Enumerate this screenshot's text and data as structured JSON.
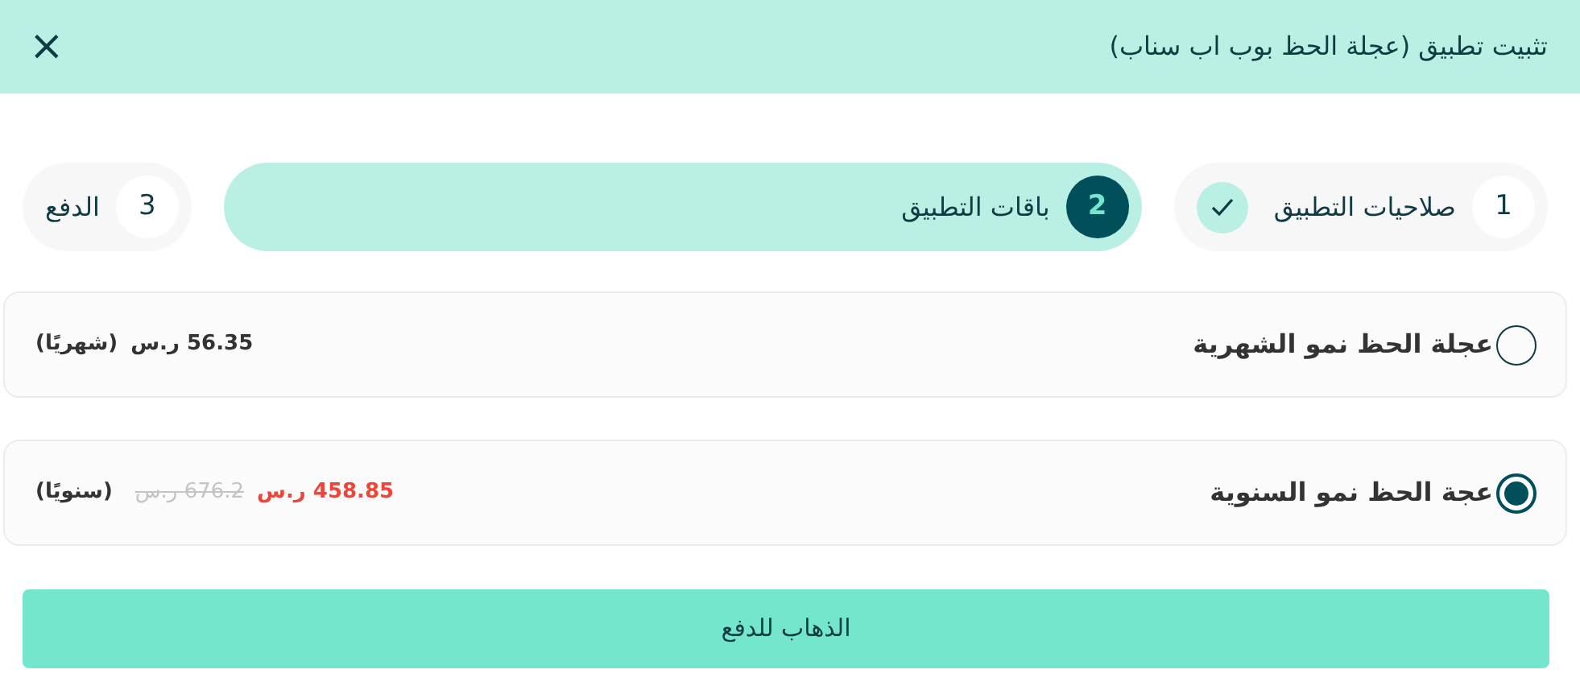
{
  "dialog": {
    "title": "تثبيت تطبيق (عجلة الحظ بوب اب سناب)",
    "close": "×"
  },
  "steps": [
    {
      "number": "1",
      "label": "صلاحيات التطبيق",
      "selected": false,
      "completed": true
    },
    {
      "number": "2",
      "label": "باقات التطبيق",
      "selected": true,
      "completed": false
    },
    {
      "number": "3",
      "label": "الدفع",
      "selected": false,
      "completed": false
    }
  ],
  "plans": [
    {
      "name": "عجلة الحظ نمو الشهرية",
      "selected": false,
      "price": "56.35 ر.س",
      "period": "(شهريًا)"
    },
    {
      "name": "عجة الحظ نمو السنوية",
      "selected": true,
      "price": "458.85 ر.س",
      "old_price": "676.2 ر.س",
      "period": "(سنويًا)"
    }
  ],
  "primary_button": "الذهاب للدفع"
}
